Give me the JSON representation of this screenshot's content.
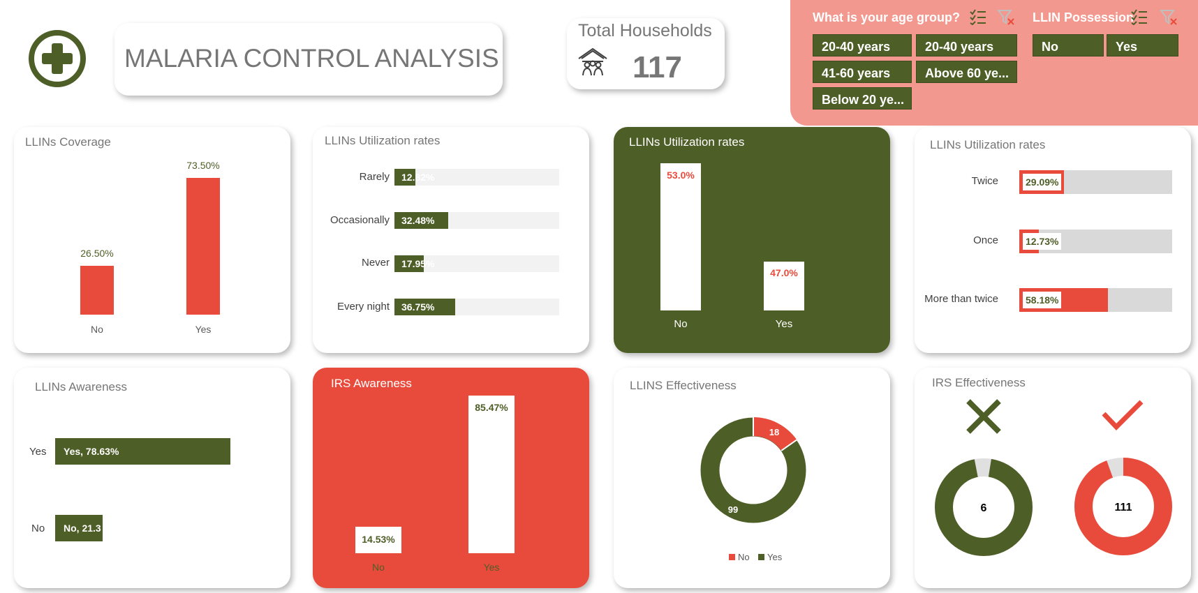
{
  "header": {
    "title": "MALARIA CONTROL ANALYSIS",
    "total_label": "Total Households",
    "total_value": "117"
  },
  "slicers": {
    "age_title": "What is your age group?",
    "age_options": [
      "20-40 years",
      "20-40 years",
      "41-60 years",
      "Above 60 ye...",
      "Below 20 ye..."
    ],
    "possession_title": "LLIN Possession",
    "possession_options": [
      "No",
      "Yes"
    ]
  },
  "coverage": {
    "title": "LLINs Coverage",
    "chart_data": {
      "type": "bar",
      "categories": [
        "No",
        "Yes"
      ],
      "values": [
        26.5,
        73.5
      ],
      "labels": [
        "26.50%",
        "73.50%"
      ],
      "color": "#e84b3c"
    }
  },
  "util_frequency": {
    "title": "LLINs Utilization rates",
    "chart_data": {
      "type": "bar",
      "orientation": "horizontal",
      "categories": [
        "Rarely",
        "Occasionally",
        "Never",
        "Every night"
      ],
      "values": [
        12.82,
        32.48,
        17.95,
        36.75
      ],
      "labels": [
        "12.82%",
        "32.48%",
        "17.95%",
        "36.75%"
      ],
      "color": "#4e5e27"
    }
  },
  "util_yesno": {
    "title": "LLINs Utilization rates",
    "chart_data": {
      "type": "bar",
      "categories": [
        "No",
        "Yes"
      ],
      "values": [
        53.0,
        47.0
      ],
      "labels": [
        "53.0%",
        "47.0%"
      ],
      "color": "#ffffff"
    }
  },
  "util_times": {
    "title": "LLINs Utilization rates",
    "chart_data": {
      "type": "bar",
      "orientation": "horizontal",
      "categories": [
        "Twice",
        "Once",
        "More than twice"
      ],
      "values": [
        29.09,
        12.73,
        58.18
      ],
      "labels": [
        "29.09%",
        "12.73%",
        "58.18%"
      ],
      "color": "#e84b3c"
    }
  },
  "llin_awareness": {
    "title": "LLINs Awareness",
    "chart_data": {
      "type": "bar",
      "orientation": "horizontal",
      "categories": [
        "Yes",
        "No"
      ],
      "values": [
        78.63,
        21.37
      ],
      "labels": [
        "Yes, 78.63%",
        "No, 21.3"
      ],
      "color": "#4e5e27"
    }
  },
  "irs_awareness": {
    "title": "IRS Awareness",
    "chart_data": {
      "type": "bar",
      "categories": [
        "No",
        "Yes"
      ],
      "values": [
        14.53,
        85.47
      ],
      "labels": [
        "14.53%",
        "85.47%"
      ],
      "color": "#ffffff"
    }
  },
  "llins_effectiveness": {
    "title": "LLINS Effectiveness",
    "chart_data": {
      "type": "pie",
      "donut": true,
      "categories": [
        "No",
        "Yes"
      ],
      "values": [
        18,
        99
      ],
      "colors": [
        "#e84b3c",
        "#4e5e27"
      ],
      "legend": "bottom"
    }
  },
  "irs_effectiveness": {
    "title": "IRS Effectiveness",
    "chart_data": [
      {
        "type": "pie",
        "donut": true,
        "values": [
          6,
          111
        ],
        "center_label": "6",
        "colors": [
          "#4e5e27",
          "#e0e0e0"
        ]
      },
      {
        "type": "pie",
        "donut": true,
        "values": [
          111,
          6
        ],
        "center_label": "111",
        "colors": [
          "#e84b3c",
          "#e0e0e0"
        ]
      }
    ]
  },
  "colors": {
    "green": "#4e5e27",
    "red": "#e84b3c",
    "slicer_bg": "#f2988f",
    "track": "#f2f2f2"
  },
  "icons": [
    "plus-circle-icon",
    "house-people-icon",
    "multi-select-icon",
    "clear-filter-icon",
    "cross-icon",
    "check-icon"
  ]
}
